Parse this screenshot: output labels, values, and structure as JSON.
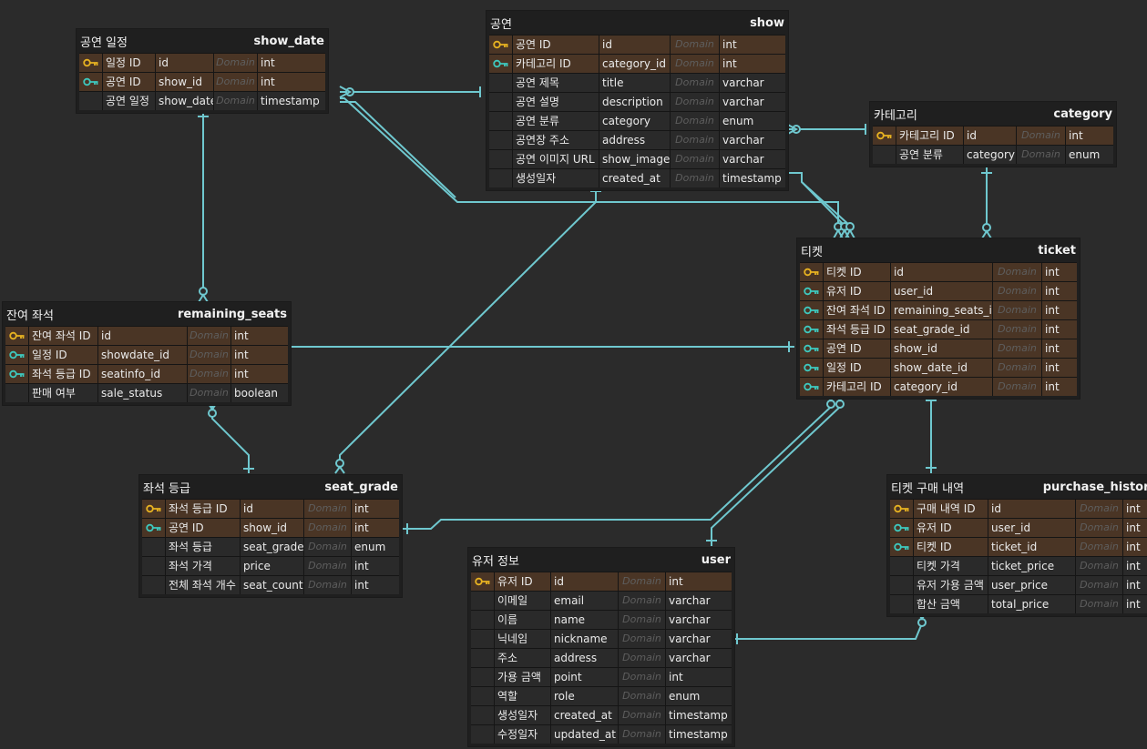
{
  "colors": {
    "primary_key": "#e8b321",
    "foreign_key": "#3ec9bf",
    "relation_line": "#6fc8cf",
    "key_row": "#4a3525"
  },
  "tables": {
    "show_date": {
      "title": "공연 일정",
      "name": "show_date",
      "columns": [
        {
          "logical": "일정 ID",
          "physical": "id",
          "domain": "Domain",
          "type": "int",
          "key": "pk"
        },
        {
          "logical": "공연 ID",
          "physical": "show_id",
          "domain": "Domain",
          "type": "int",
          "key": "fk"
        },
        {
          "logical": "공연 일정",
          "physical": "show_date",
          "domain": "Domain",
          "type": "timestamp",
          "key": ""
        }
      ]
    },
    "show": {
      "title": "공연",
      "name": "show",
      "columns": [
        {
          "logical": "공연 ID",
          "physical": "id",
          "domain": "Domain",
          "type": "int",
          "key": "pk"
        },
        {
          "logical": "카테고리 ID",
          "physical": "category_id",
          "domain": "Domain",
          "type": "int",
          "key": "fk"
        },
        {
          "logical": "공연 제목",
          "physical": "title",
          "domain": "Domain",
          "type": "varchar",
          "key": ""
        },
        {
          "logical": "공연 설명",
          "physical": "description",
          "domain": "Domain",
          "type": "varchar",
          "key": ""
        },
        {
          "logical": "공연 분류",
          "physical": "category",
          "domain": "Domain",
          "type": "enum",
          "key": ""
        },
        {
          "logical": "공연장 주소",
          "physical": "address",
          "domain": "Domain",
          "type": "varchar",
          "key": ""
        },
        {
          "logical": "공연 이미지 URL",
          "physical": "show_image",
          "domain": "Domain",
          "type": "varchar",
          "key": ""
        },
        {
          "logical": "생성일자",
          "physical": "created_at",
          "domain": "Domain",
          "type": "timestamp",
          "key": ""
        }
      ]
    },
    "category": {
      "title": "카테고리",
      "name": "category",
      "columns": [
        {
          "logical": "카테고리 ID",
          "physical": "id",
          "domain": "Domain",
          "type": "int",
          "key": "pk"
        },
        {
          "logical": "공연 분류",
          "physical": "category",
          "domain": "Domain",
          "type": "enum",
          "key": ""
        }
      ]
    },
    "ticket": {
      "title": "티켓",
      "name": "ticket",
      "columns": [
        {
          "logical": "티켓 ID",
          "physical": "id",
          "domain": "Domain",
          "type": "int",
          "key": "pk"
        },
        {
          "logical": "유저 ID",
          "physical": "user_id",
          "domain": "Domain",
          "type": "int",
          "key": "fk"
        },
        {
          "logical": "잔여 좌석 ID",
          "physical": "remaining_seats_id",
          "domain": "Domain",
          "type": "int",
          "key": "fk"
        },
        {
          "logical": "좌석 등급 ID",
          "physical": "seat_grade_id",
          "domain": "Domain",
          "type": "int",
          "key": "fk"
        },
        {
          "logical": "공연 ID",
          "physical": "show_id",
          "domain": "Domain",
          "type": "int",
          "key": "fk"
        },
        {
          "logical": "일정 ID",
          "physical": "show_date_id",
          "domain": "Domain",
          "type": "int",
          "key": "fk"
        },
        {
          "logical": "카테고리 ID",
          "physical": "category_id",
          "domain": "Domain",
          "type": "int",
          "key": "fk"
        }
      ]
    },
    "remaining_seats": {
      "title": "잔여 좌석",
      "name": "remaining_seats",
      "columns": [
        {
          "logical": "잔여 좌석 ID",
          "physical": "id",
          "domain": "Domain",
          "type": "int",
          "key": "pk"
        },
        {
          "logical": "일정 ID",
          "physical": "showdate_id",
          "domain": "Domain",
          "type": "int",
          "key": "fk"
        },
        {
          "logical": "좌석 등급 ID",
          "physical": "seatinfo_id",
          "domain": "Domain",
          "type": "int",
          "key": "fk"
        },
        {
          "logical": "판매 여부",
          "physical": "sale_status",
          "domain": "Domain",
          "type": "boolean",
          "key": ""
        }
      ]
    },
    "seat_grade": {
      "title": "좌석 등급",
      "name": "seat_grade",
      "columns": [
        {
          "logical": "좌석 등급 ID",
          "physical": "id",
          "domain": "Domain",
          "type": "int",
          "key": "pk"
        },
        {
          "logical": "공연 ID",
          "physical": "show_id",
          "domain": "Domain",
          "type": "int",
          "key": "fk"
        },
        {
          "logical": "좌석 등급",
          "physical": "seat_grade",
          "domain": "Domain",
          "type": "enum",
          "key": ""
        },
        {
          "logical": "좌석 가격",
          "physical": "price",
          "domain": "Domain",
          "type": "int",
          "key": ""
        },
        {
          "logical": "전체 좌석 개수",
          "physical": "seat_count",
          "domain": "Domain",
          "type": "int",
          "key": ""
        }
      ]
    },
    "user": {
      "title": "유저 정보",
      "name": "user",
      "columns": [
        {
          "logical": "유저 ID",
          "physical": "id",
          "domain": "Domain",
          "type": "int",
          "key": "pk"
        },
        {
          "logical": "이메일",
          "physical": "email",
          "domain": "Domain",
          "type": "varchar",
          "key": ""
        },
        {
          "logical": "이름",
          "physical": "name",
          "domain": "Domain",
          "type": "varchar",
          "key": ""
        },
        {
          "logical": "닉네임",
          "physical": "nickname",
          "domain": "Domain",
          "type": "varchar",
          "key": ""
        },
        {
          "logical": "주소",
          "physical": "address",
          "domain": "Domain",
          "type": "varchar",
          "key": ""
        },
        {
          "logical": "가용 금액",
          "physical": "point",
          "domain": "Domain",
          "type": "int",
          "key": ""
        },
        {
          "logical": "역할",
          "physical": "role",
          "domain": "Domain",
          "type": "enum",
          "key": ""
        },
        {
          "logical": "생성일자",
          "physical": "created_at",
          "domain": "Domain",
          "type": "timestamp",
          "key": ""
        },
        {
          "logical": "수정일자",
          "physical": "updated_at",
          "domain": "Domain",
          "type": "timestamp",
          "key": ""
        }
      ]
    },
    "purchase_history": {
      "title": "티켓 구매 내역",
      "name": "purchase_history",
      "columns": [
        {
          "logical": "구매 내역 ID",
          "physical": "id",
          "domain": "Domain",
          "type": "int",
          "key": "pk"
        },
        {
          "logical": "유저 ID",
          "physical": "user_id",
          "domain": "Domain",
          "type": "int",
          "key": "fk"
        },
        {
          "logical": "티켓 ID",
          "physical": "ticket_id",
          "domain": "Domain",
          "type": "int",
          "key": "fk"
        },
        {
          "logical": "티켓 가격",
          "physical": "ticket_price",
          "domain": "Domain",
          "type": "int",
          "key": ""
        },
        {
          "logical": "유저 가용 금액",
          "physical": "user_price",
          "domain": "Domain",
          "type": "int",
          "key": ""
        },
        {
          "logical": "합산 금액",
          "physical": "total_price",
          "domain": "Domain",
          "type": "int",
          "key": ""
        }
      ]
    }
  }
}
